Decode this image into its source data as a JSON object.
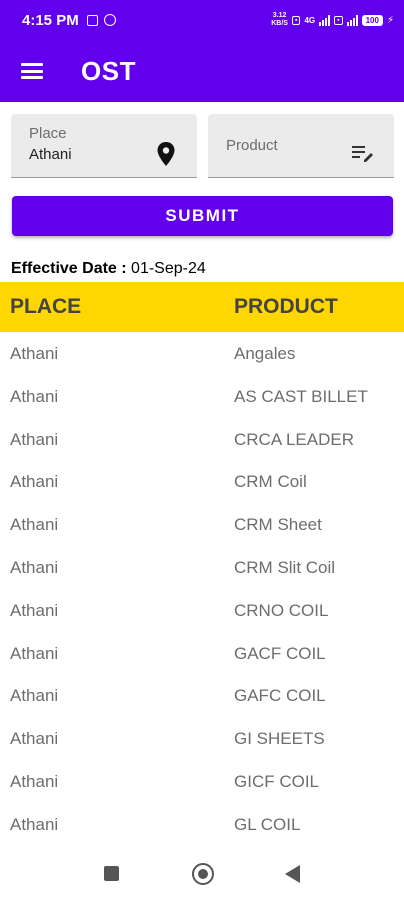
{
  "status_bar": {
    "time": "4:15 PM",
    "net_speed": "3.12",
    "net_speed_unit": "KB/S",
    "network_type": "4G",
    "battery": "100"
  },
  "app_bar": {
    "title": "OST",
    "menu_icon": "hamburger-menu-icon"
  },
  "form": {
    "place_label": "Place",
    "place_value": "Athani",
    "place_icon": "location-pin-icon",
    "product_label": "Product",
    "product_icon": "edit-list-icon",
    "submit_label": "SUBMIT"
  },
  "effective": {
    "label": "Effective Date :",
    "value": "01-Sep-24"
  },
  "table": {
    "headers": {
      "place": "PLACE",
      "product": "PRODUCT"
    },
    "rows": [
      {
        "place": "Athani",
        "product": "Angales"
      },
      {
        "place": "Athani",
        "product": "AS CAST BILLET"
      },
      {
        "place": "Athani",
        "product": "CRCA LEADER"
      },
      {
        "place": "Athani",
        "product": "CRM Coil"
      },
      {
        "place": "Athani",
        "product": "CRM Sheet"
      },
      {
        "place": "Athani",
        "product": "CRM Slit Coil"
      },
      {
        "place": "Athani",
        "product": "CRNO COIL"
      },
      {
        "place": "Athani",
        "product": "GACF COIL"
      },
      {
        "place": "Athani",
        "product": "GAFC COIL"
      },
      {
        "place": "Athani",
        "product": "GI SHEETS"
      },
      {
        "place": "Athani",
        "product": "GICF COIL"
      },
      {
        "place": "Athani",
        "product": "GL COIL"
      }
    ]
  },
  "nav_bar": {
    "recents_icon": "square-recents-icon",
    "home_icon": "circle-home-icon",
    "back_icon": "triangle-back-icon"
  },
  "colors": {
    "primary": "#6200ee",
    "header_bg": "#ffd700",
    "field_bg": "#ebebeb"
  }
}
